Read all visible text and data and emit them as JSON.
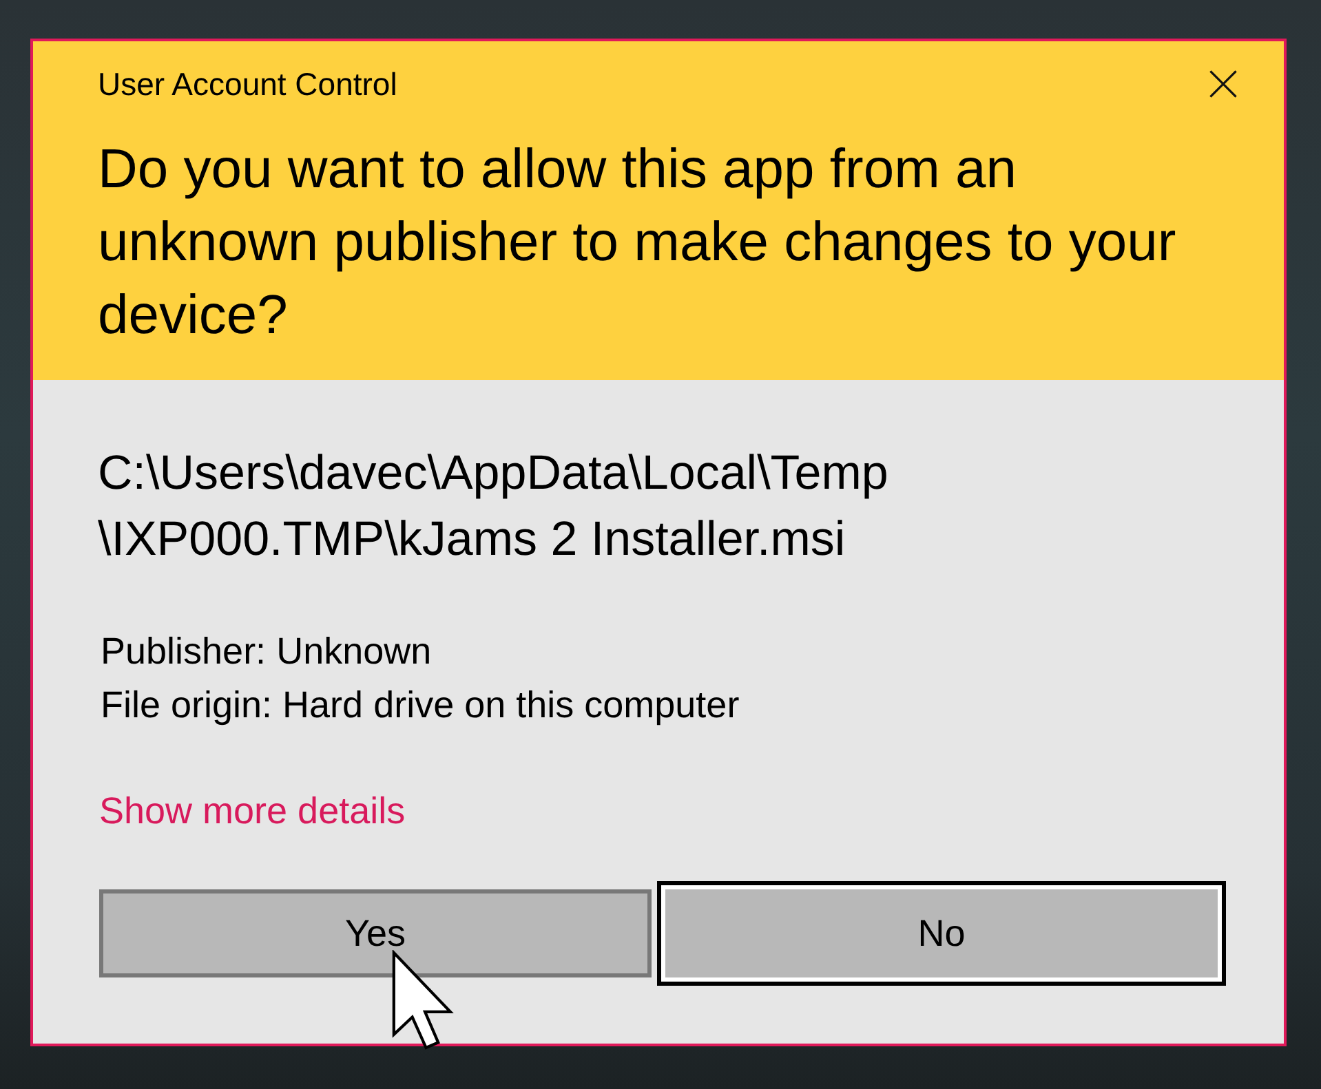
{
  "window": {
    "title": "User Account Control"
  },
  "header": {
    "question": "Do you want to allow this app from an unknown publisher to make changes to your device?"
  },
  "details": {
    "file_path_lines": [
      "C:\\Users\\davec\\AppData\\Local\\Temp",
      "\\IXP000.TMP\\kJams 2 Installer.msi"
    ],
    "info_lines": [
      "Publisher: Unknown",
      "File origin: Hard drive on this computer"
    ],
    "link": "Show more details"
  },
  "buttons": [
    {
      "label": "Yes",
      "hovered": true,
      "focused": false
    },
    {
      "label": "No",
      "hovered": false,
      "focused": true
    }
  ]
}
